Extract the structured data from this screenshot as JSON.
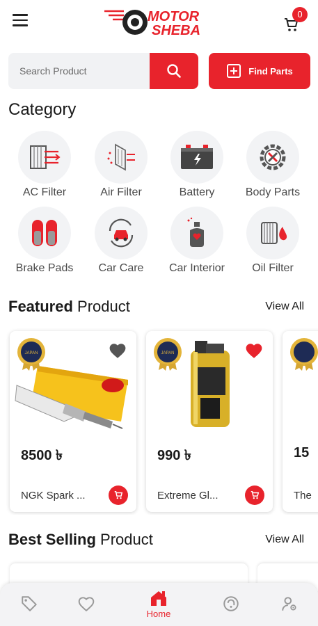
{
  "header": {
    "logo_line1": "MOTOR",
    "logo_line2": "SHEBA",
    "cart_count": "0"
  },
  "search": {
    "placeholder": "Search Product"
  },
  "find_parts": {
    "label": "Find Parts"
  },
  "category": {
    "title": "Category",
    "items": [
      {
        "label": "AC Filter",
        "icon": "ac-filter-icon"
      },
      {
        "label": "Air Filter",
        "icon": "air-filter-icon"
      },
      {
        "label": "Battery",
        "icon": "battery-icon"
      },
      {
        "label": "Body Parts",
        "icon": "body-parts-icon"
      },
      {
        "label": "Brake Pads",
        "icon": "brake-pads-icon"
      },
      {
        "label": "Car Care",
        "icon": "car-care-icon"
      },
      {
        "label": "Car Interior",
        "icon": "car-interior-icon"
      },
      {
        "label": "Oil Filter",
        "icon": "oil-filter-icon"
      }
    ]
  },
  "featured": {
    "title_bold": "Featured",
    "title_rest": " Product",
    "view_all": "View All",
    "products": [
      {
        "price": "8500 ৳",
        "name": "NGK Spark ...",
        "favorited": false
      },
      {
        "price": "990 ৳",
        "name": "Extreme Gl...",
        "favorited": true
      },
      {
        "price": "15",
        "name": "The"
      }
    ]
  },
  "best_selling": {
    "title_bold": "Best Selling",
    "title_rest": " Product",
    "view_all": "View All"
  },
  "bottom_nav": {
    "home_label": "Home"
  },
  "colors": {
    "accent": "#e8232c",
    "background": "#ffffff",
    "tile": "#f2f3f5"
  }
}
